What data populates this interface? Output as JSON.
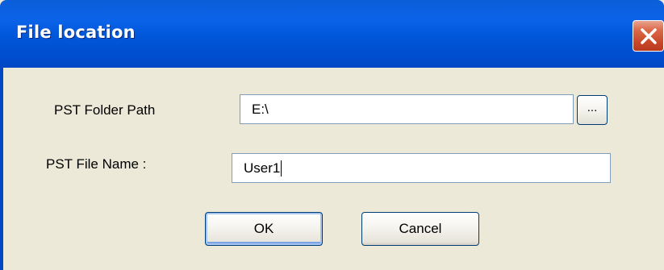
{
  "dialog": {
    "title": "File location",
    "folder_label": "PST Folder Path",
    "folder_value": "E:\\",
    "browse_label": "...",
    "file_label": "PST File Name :",
    "file_value": "User1",
    "ok_label": "OK",
    "cancel_label": "Cancel"
  },
  "icons": {
    "close": "close-icon"
  },
  "colors": {
    "titlebar": "#0054e3",
    "close_button": "#d9593a",
    "dialog_background": "#ece9d8",
    "field_border": "#7f9db9",
    "button_border": "#003c74"
  }
}
